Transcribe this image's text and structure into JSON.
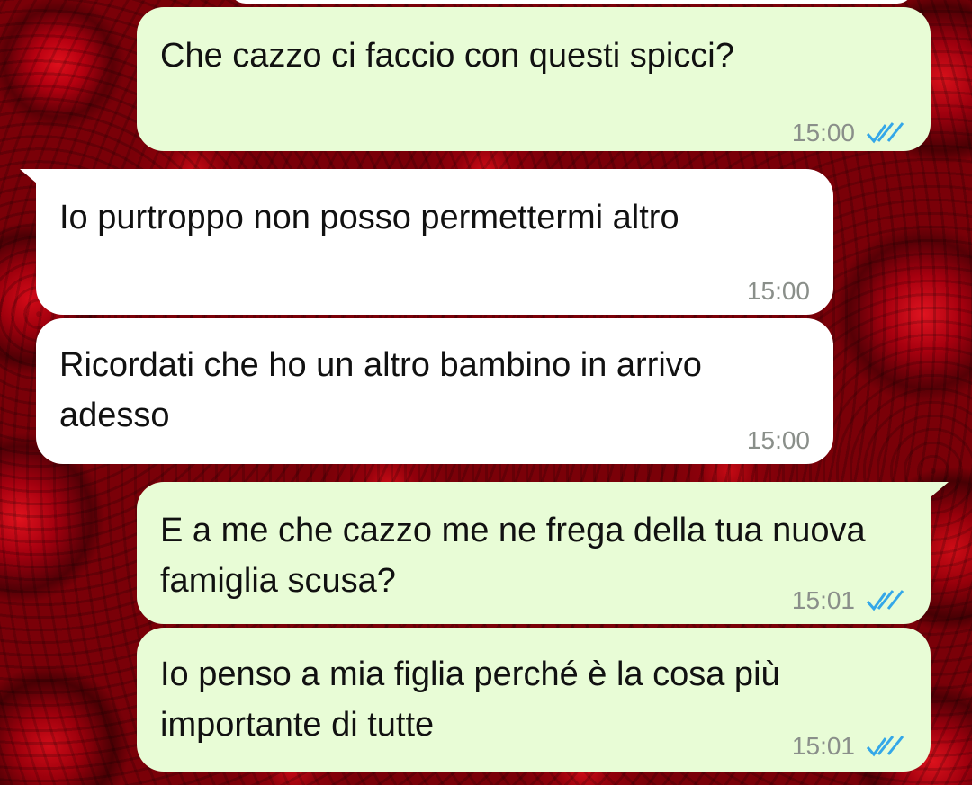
{
  "messages": [
    {
      "direction": "out",
      "text": "Che cazzo ci faccio con questi spicci?",
      "time": "15:00",
      "status": "read-ticks-icon"
    },
    {
      "direction": "in",
      "text": "Io purtroppo non posso permettermi altro",
      "time": "15:00"
    },
    {
      "direction": "in",
      "text": "Ricordati che ho un altro bambino in arrivo adesso",
      "time": "15:00"
    },
    {
      "direction": "out",
      "text": "E a me che cazzo me ne frega della tua nuova famiglia scusa?",
      "time": "15:01",
      "status": "read-ticks-icon"
    },
    {
      "direction": "out",
      "text": "Io penso a mia figlia perché è la cosa più importante di tutte",
      "time": "15:01",
      "status": "read-ticks-icon"
    }
  ],
  "colors": {
    "outgoing_bubble": "#e8fcd6",
    "incoming_bubble": "#ffffff",
    "read_ticks": "#34a7e8",
    "timestamp": "#8a8f8a",
    "wallpaper": "#b50010"
  }
}
